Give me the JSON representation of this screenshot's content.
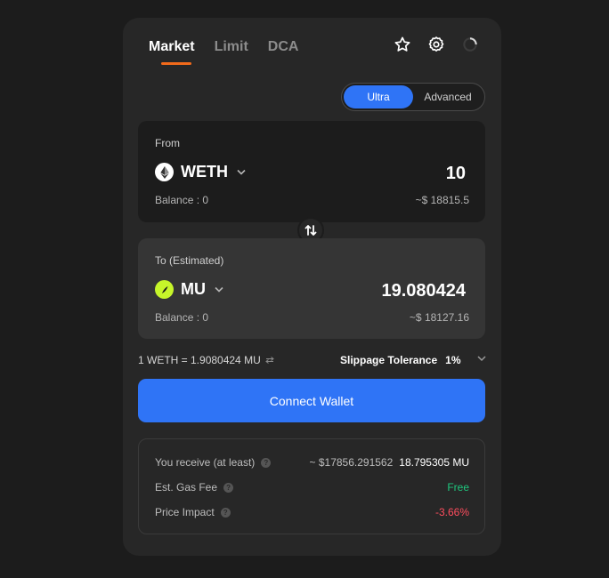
{
  "tabs": [
    {
      "label": "Market",
      "active": true
    },
    {
      "label": "Limit",
      "active": false
    },
    {
      "label": "DCA",
      "active": false
    }
  ],
  "header_icons": [
    "star-icon",
    "settings-icon",
    "refresh-icon"
  ],
  "mode": {
    "ultra": "Ultra",
    "advanced": "Advanced",
    "active": "Ultra"
  },
  "from": {
    "label": "From",
    "token": "WETH",
    "token_icon": "ethereum-icon",
    "amount": "10",
    "balance": "Balance : 0",
    "usd": "~$ 18815.5"
  },
  "to": {
    "label": "To (Estimated)",
    "token": "MU",
    "token_icon": "mu-token-icon",
    "amount": "19.080424",
    "balance": "Balance : 0",
    "usd": "~$ 18127.16"
  },
  "rate": "1 WETH = 1.9080424 MU",
  "slippage": {
    "label": "Slippage Tolerance",
    "value": "1%"
  },
  "connect_label": "Connect Wallet",
  "summary": {
    "receive_label": "You receive (at least)",
    "receive_usd": "~ $17856.291562",
    "receive_amount": "18.795305 MU",
    "gas_label": "Est. Gas Fee",
    "gas_value": "Free",
    "impact_label": "Price Impact",
    "impact_value": "-3.66%"
  },
  "colors": {
    "accent": "#2f74f6",
    "tab_indicator": "#f26a1b",
    "positive": "#1fc77e",
    "negative": "#ff4d5e",
    "mu_token": "#c6f52a"
  }
}
